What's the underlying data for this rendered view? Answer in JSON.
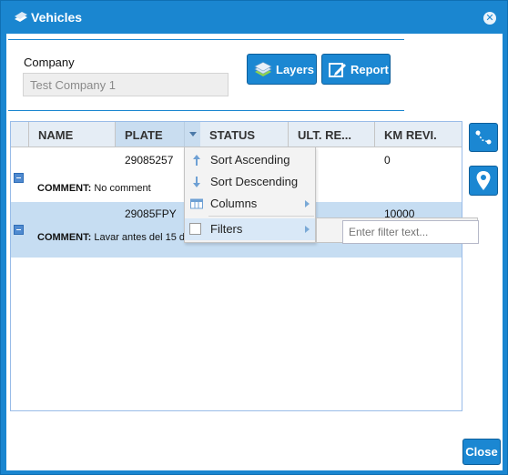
{
  "window": {
    "title": "Vehicles"
  },
  "company": {
    "label": "Company",
    "value": "Test Company 1"
  },
  "toolbar": {
    "layers_label": "Layers",
    "report_label": "Report"
  },
  "grid": {
    "columns": [
      "NAME",
      "PLATE",
      "STATUS",
      "ULT. RE...",
      "KM REVI."
    ],
    "rows": [
      {
        "plate": "29085257",
        "km_revi": "0",
        "comment_label": "COMMENT:",
        "comment": "No comment"
      },
      {
        "plate": "29085FPY",
        "km_revi": "10000",
        "comment_label": "COMMENT:",
        "comment": "Lavar antes del 15 de Mayo"
      }
    ]
  },
  "column_menu": {
    "sort_asc": "Sort Ascending",
    "sort_desc": "Sort Descending",
    "columns": "Columns",
    "filters": "Filters",
    "filter_placeholder": "Enter filter text..."
  },
  "footer": {
    "close_label": "Close"
  },
  "colors": {
    "accent": "#1a86d0",
    "row_selected": "#c6ddf2",
    "header_bg": "#e5edf5"
  },
  "icons": [
    "vehicles-icon",
    "close-icon",
    "layers-icon",
    "report-icon",
    "route-icon",
    "map-pin-icon"
  ]
}
